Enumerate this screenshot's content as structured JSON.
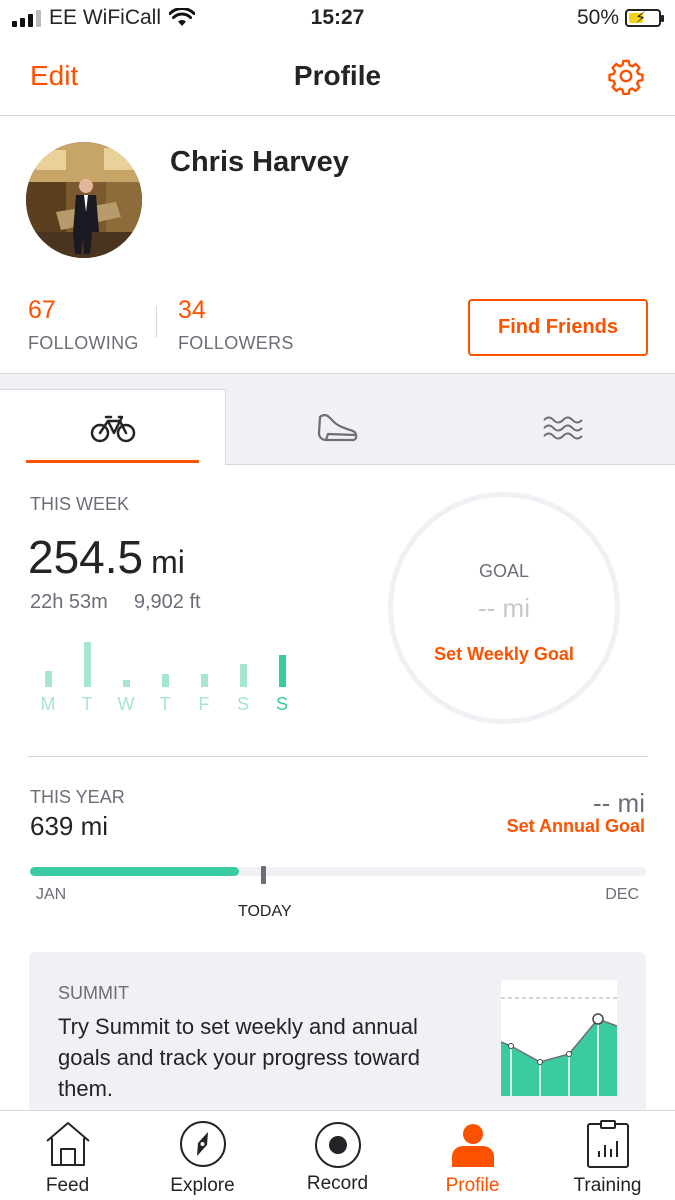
{
  "status_bar": {
    "carrier": "EE WiFiCall",
    "time": "15:27",
    "battery": "50%",
    "battery_level": 0.5
  },
  "nav": {
    "edit": "Edit",
    "title": "Profile",
    "settings_icon": "gear-icon"
  },
  "profile": {
    "name": "Chris Harvey",
    "following_count": "67",
    "following_label": "FOLLOWING",
    "followers_count": "34",
    "followers_label": "FOLLOWERS",
    "find_friends": "Find Friends"
  },
  "sport_tabs": [
    {
      "icon": "bike-icon",
      "active": true
    },
    {
      "icon": "shoe-icon",
      "active": false
    },
    {
      "icon": "swim-icon",
      "active": false
    }
  ],
  "this_week": {
    "label": "THIS WEEK",
    "distance": "254.5",
    "unit": "mi",
    "time": "22h 53m",
    "elevation": "9,902 ft",
    "days": [
      {
        "letter": "M",
        "level": 0.35
      },
      {
        "letter": "T",
        "level": 1.0
      },
      {
        "letter": "W",
        "level": 0.15
      },
      {
        "letter": "T",
        "level": 0.28
      },
      {
        "letter": "F",
        "level": 0.28
      },
      {
        "letter": "S",
        "level": 0.52
      },
      {
        "letter": "S",
        "level": 0.72
      }
    ],
    "today_index": 6
  },
  "goal": {
    "label": "GOAL",
    "value": "-- mi",
    "set_label": "Set Weekly Goal"
  },
  "this_year": {
    "label": "THIS YEAR",
    "distance": "639 mi",
    "goal": "-- mi",
    "set_label": "Set Annual Goal",
    "start": "JAN",
    "end": "DEC",
    "today": "TODAY",
    "progress": 0.34
  },
  "summit": {
    "label": "SUMMIT",
    "text": "Try Summit to set weekly and annual goals and track your progress toward them."
  },
  "tab_bar": [
    {
      "label": "Feed",
      "icon": "home-icon",
      "active": false
    },
    {
      "label": "Explore",
      "icon": "compass-icon",
      "active": false
    },
    {
      "label": "Record",
      "icon": "record-icon",
      "active": false
    },
    {
      "label": "Profile",
      "icon": "person-icon",
      "active": true
    },
    {
      "label": "Training",
      "icon": "clipboard-chart-icon",
      "active": false
    }
  ],
  "colors": {
    "brand": "#fc5200",
    "accent_green": "#3acca0",
    "light_green": "#a6e5d4"
  }
}
